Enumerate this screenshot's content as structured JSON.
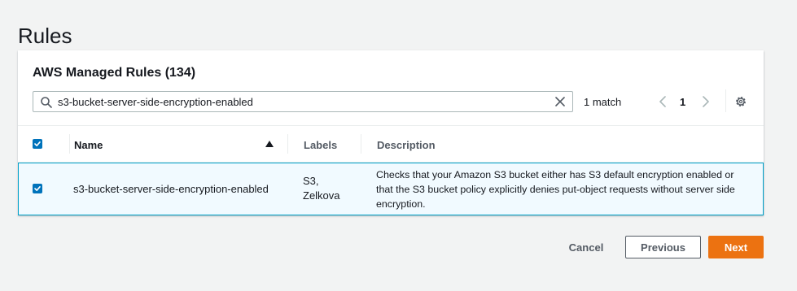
{
  "page": {
    "title": "Rules"
  },
  "panel": {
    "title": "AWS Managed Rules (134)",
    "search": {
      "value": "s3-bucket-server-side-encryption-enabled",
      "placeholder": ""
    },
    "match_count": "1 match",
    "pagination": {
      "current_page": "1"
    }
  },
  "table": {
    "headers": {
      "name": "Name",
      "labels": "Labels",
      "description": "Description"
    },
    "sort": {
      "column": "Name",
      "direction": "ascending"
    },
    "rows": [
      {
        "selected": true,
        "name": "s3-bucket-server-side-encryption-enabled",
        "labels_line1": "S3,",
        "labels_line2": "Zelkova",
        "description": "Checks that your Amazon S3 bucket either has S3 default encryption enabled or that the S3 bucket policy explicitly denies put-object requests without server side encryption."
      }
    ]
  },
  "footer": {
    "cancel_label": "Cancel",
    "previous_label": "Previous",
    "next_label": "Next"
  },
  "colors": {
    "primary_button": "#ec7211",
    "checkbox": "#0073bb",
    "selected_row_border": "#00a1c9",
    "selected_row_bg": "#f1faff"
  }
}
